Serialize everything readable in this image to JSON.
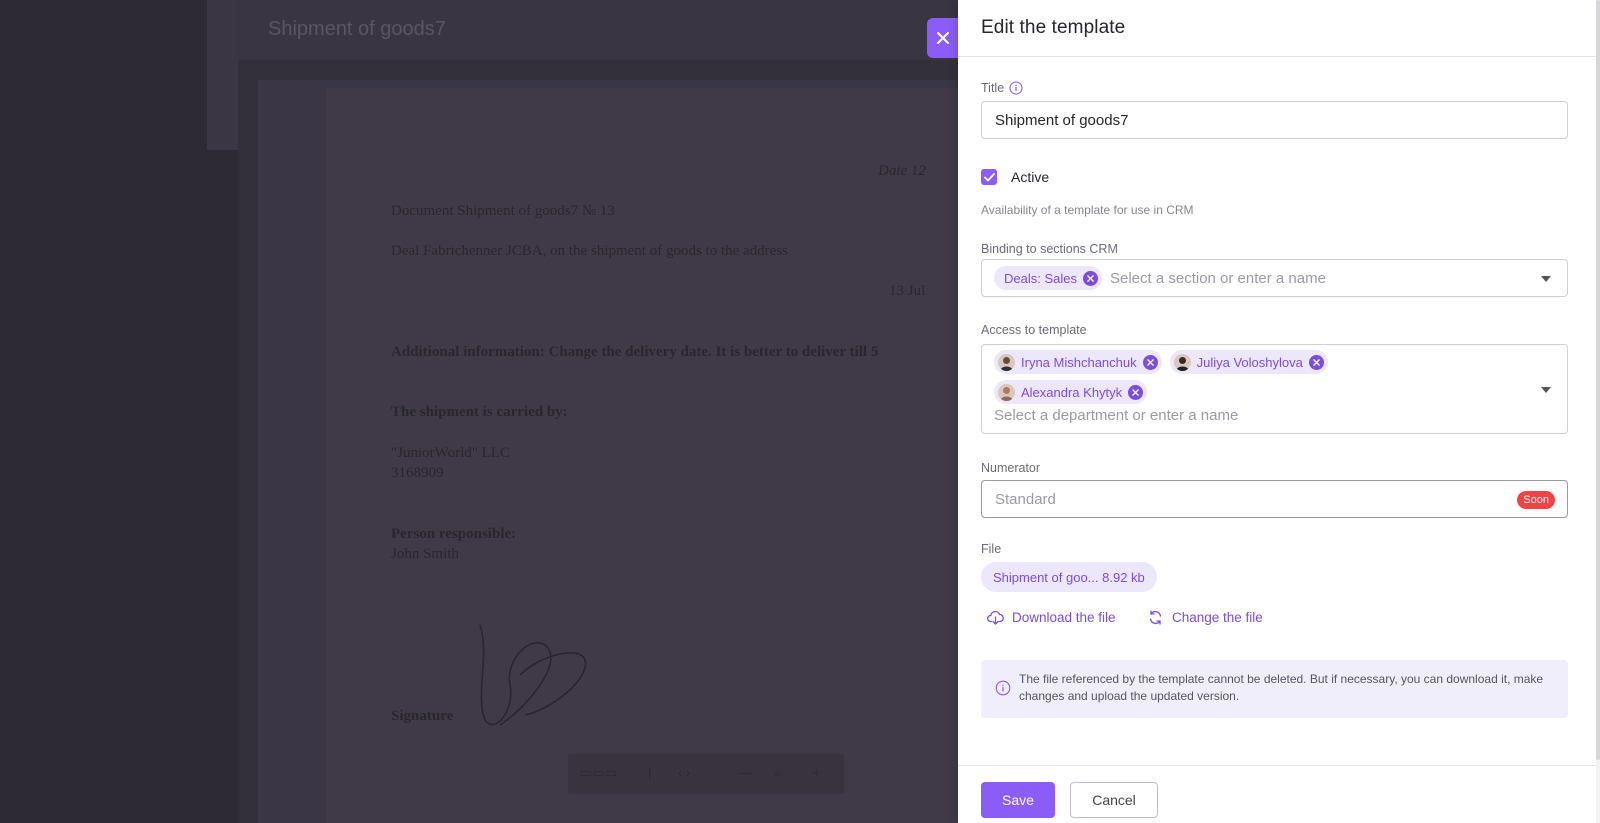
{
  "background": {
    "doc_title": "Shipment of goods7",
    "date_label": "Date 12",
    "doc_line": "Document Shipment of goods7 № 13",
    "deal_line": "Deal Fabrichenner JCBA, on the shipment of goods to the address",
    "date_value": "13 Jul",
    "additional": "Additional information: Change the delivery date. It is better to deliver till 5",
    "carried_by": "The shipment is carried by:",
    "company": "\"JuniorWorld\" LLC",
    "company_code": "3168909",
    "person_label": "Person responsible:",
    "person_name": "John Smith",
    "signature_label": "Signature"
  },
  "panel": {
    "title": "Edit the template",
    "title_field": {
      "label": "Title",
      "value": "Shipment of goods7"
    },
    "active": {
      "label": "Active",
      "checked": true,
      "hint": "Availability of a template for use in CRM"
    },
    "binding": {
      "label": "Binding to sections CRM",
      "chips": [
        "Deals: Sales"
      ],
      "placeholder": "Select a section or enter a name"
    },
    "access": {
      "label": "Access to template",
      "people": [
        "Iryna Mishchanchuk",
        "Juliya Voloshylova",
        "Alexandra Khytyk"
      ],
      "placeholder": "Select a department or enter a name"
    },
    "numerator": {
      "label": "Numerator",
      "placeholder": "Standard",
      "badge": "Soon"
    },
    "file": {
      "label": "File",
      "name": "Shipment of goo... 8.92 kb",
      "download": "Download the file",
      "change": "Change the file"
    },
    "info": "The file referenced by the template cannot be deleted. But if necessary, you can download it, make changes and upload the updated version.",
    "save": "Save",
    "cancel": "Cancel"
  },
  "colors": {
    "accent": "#8b5cf6",
    "chip_bg": "#ede7fb",
    "chip_text": "#7c4ddb",
    "badge": "#ef4444",
    "overlay": "#34303b"
  },
  "icons": [
    "close-icon",
    "info-icon",
    "check-icon",
    "chip-remove-icon",
    "chevron-down-icon",
    "download-icon",
    "refresh-icon"
  ]
}
